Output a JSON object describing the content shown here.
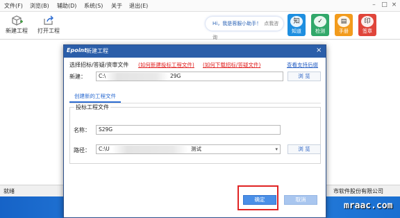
{
  "menu": {
    "items": [
      "文件(F)",
      "浏览(B)",
      "辅助(D)",
      "系统(S)",
      "关于",
      "退出(E)"
    ],
    "window_controls": [
      "–",
      "□",
      "×"
    ]
  },
  "toolbar": {
    "new_project": "新建工程",
    "open_project": "打开工程"
  },
  "help_bubble": {
    "text": "Hi，我是蓉服小助手！",
    "action": "点我咨询"
  },
  "right_buttons": [
    {
      "label": "知道",
      "icon": "知",
      "color": "#1e8fe0"
    },
    {
      "label": "检测",
      "icon": "✓",
      "color": "#31a86a"
    },
    {
      "label": "手册",
      "icon": "▤",
      "color": "#f29b1c"
    },
    {
      "label": "签章",
      "icon": "印",
      "color": "#e0453a"
    }
  ],
  "status": {
    "left": "就绪",
    "right": "市软件股份有限公司"
  },
  "watermark": "mraac.com",
  "dialog": {
    "logo": "Epoint",
    "title": "新建工程",
    "close": "×",
    "select_label": "选择招标/答疑/资审文件",
    "link_new": "(如何新建投标工程文件)",
    "link_download": "(如何下载招标/答疑文件)",
    "link_support": "查看支持后缀",
    "new_label": "新建：",
    "new_value_prefix": "C:\\",
    "new_value_suffix": "29G",
    "tab_label": "创建新的工程文件",
    "group_title": "投标工程文件",
    "name_label": "名称：",
    "name_value": "S29G",
    "path_label": "路径：",
    "path_value_prefix": "C:\\U",
    "path_value_suffix": "测试",
    "dropdown_arrow": "▾",
    "browse": "浏 览",
    "ok": "确定",
    "cancel": "取消"
  }
}
